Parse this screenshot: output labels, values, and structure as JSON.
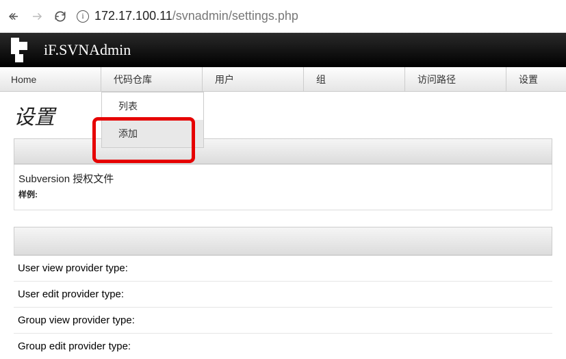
{
  "browser": {
    "url_host": "172.17.100.11",
    "url_path": "/svnadmin/settings.php"
  },
  "header": {
    "app_title": "iF.SVNAdmin"
  },
  "menu": {
    "home": "Home",
    "repo": "代码仓库",
    "user": "用户",
    "group": "组",
    "path": "访问路径",
    "settings": "设置"
  },
  "dropdown": {
    "list": "列表",
    "add": "添加"
  },
  "page": {
    "title": "设置"
  },
  "section1": {
    "label": "Subversion 授权文件",
    "sample": "样例:"
  },
  "section2": {
    "rows": [
      "User view provider type:",
      "User edit provider type:",
      "Group view provider type:",
      "Group edit provider type:"
    ]
  }
}
